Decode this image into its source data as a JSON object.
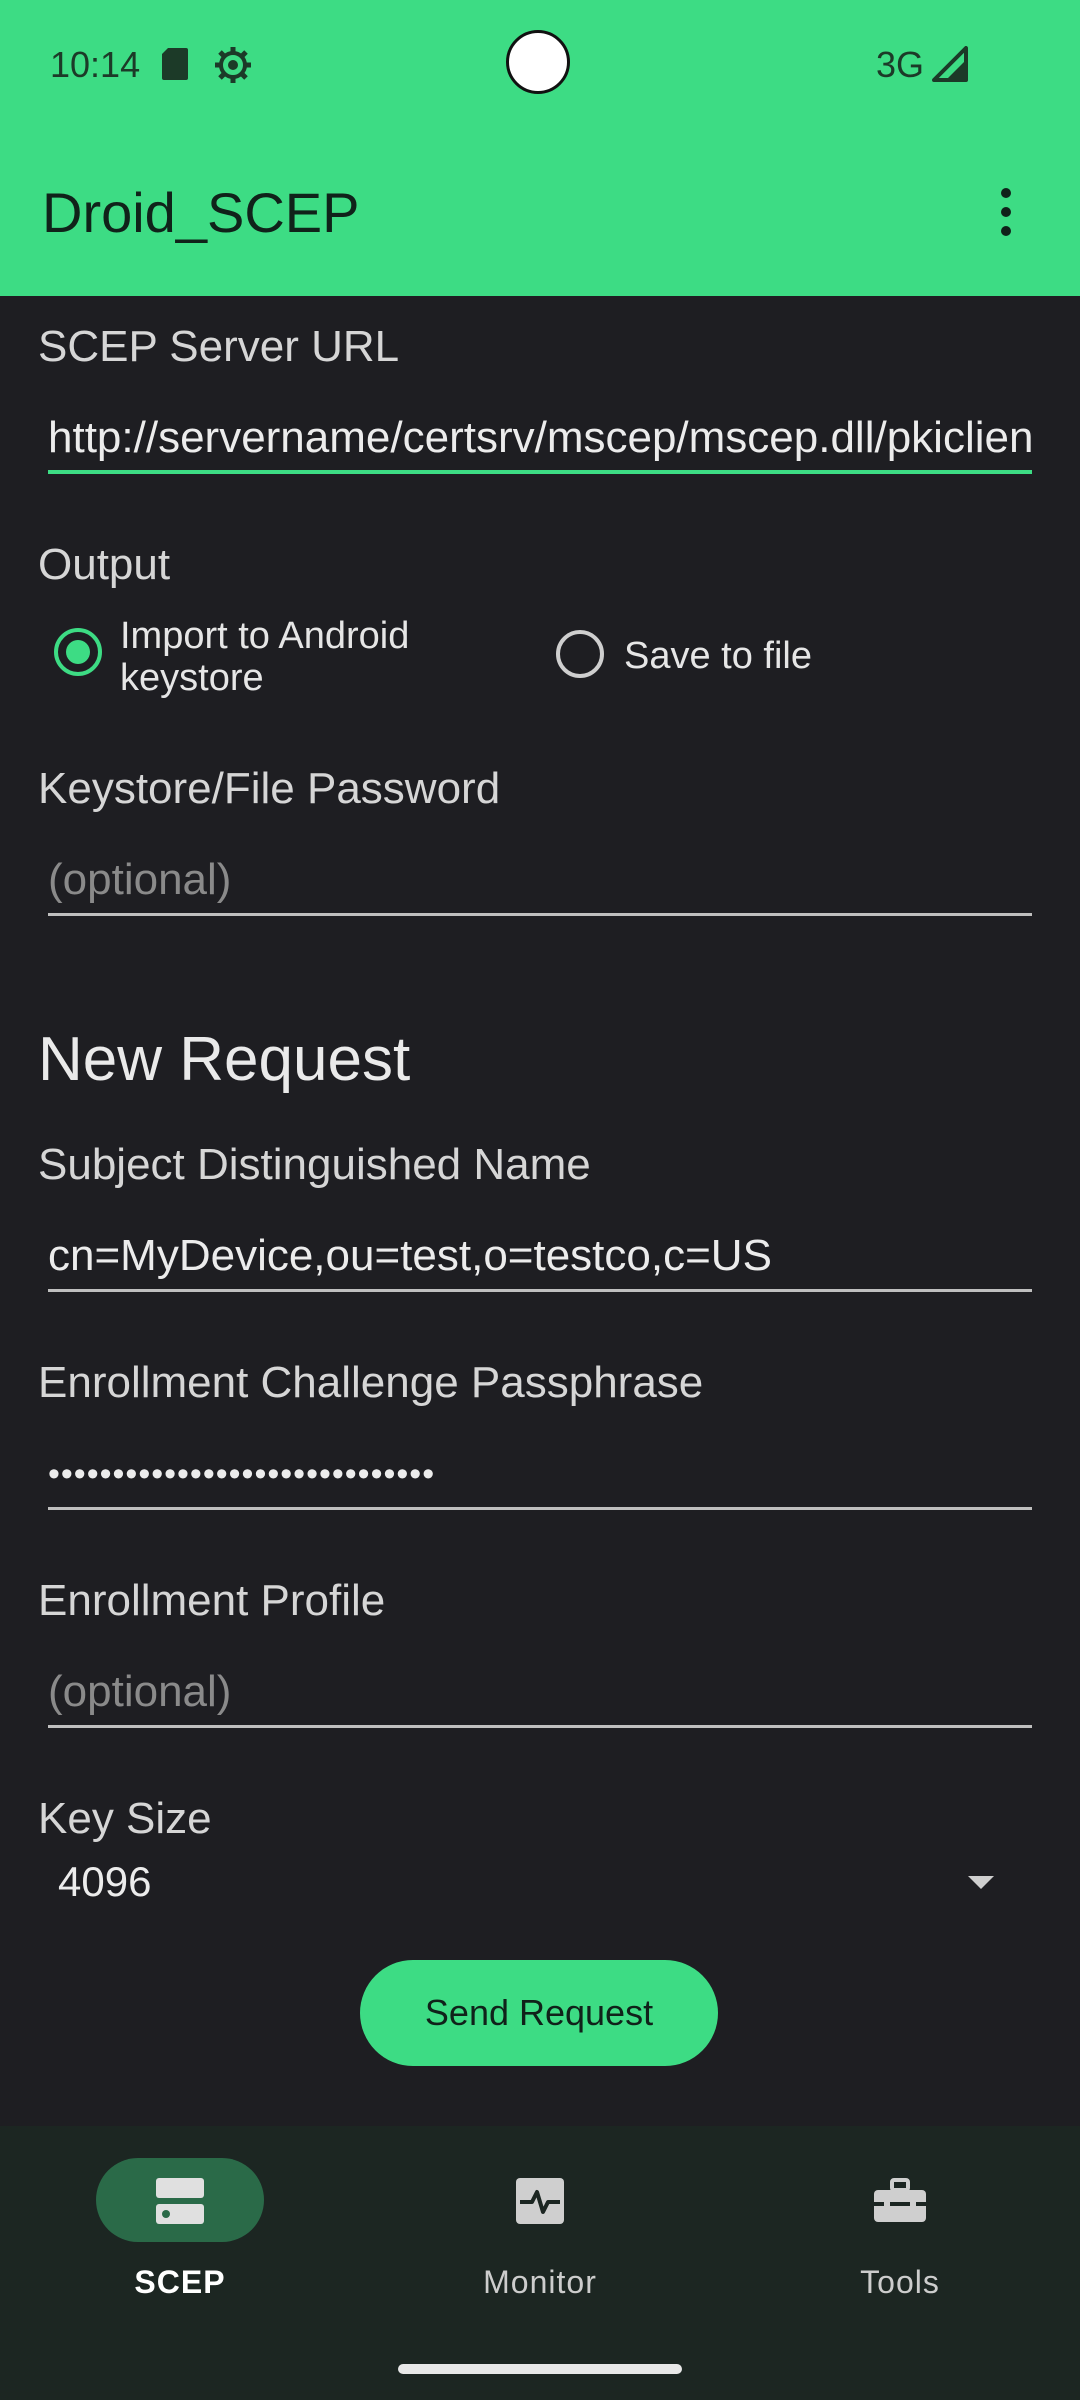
{
  "status_bar": {
    "time": "10:14",
    "network": "3G"
  },
  "app_bar": {
    "title": "Droid_SCEP"
  },
  "server": {
    "label": "SCEP Server URL",
    "value": "http://servername/certsrv/mscep/mscep.dll/pkiclient.exe"
  },
  "output": {
    "label": "Output",
    "options": [
      {
        "line1": "Import to Android",
        "line2": "keystore",
        "selected": true
      },
      {
        "label": "Save to file",
        "selected": false
      }
    ]
  },
  "password": {
    "label": "Keystore/File Password",
    "placeholder": "(optional)"
  },
  "new_request": {
    "title": "New Request",
    "subject": {
      "label": "Subject Distinguished Name",
      "value": "cn=MyDevice,ou=test,o=testco,c=US"
    },
    "challenge": {
      "label": "Enrollment Challenge Passphrase",
      "value": "••••••••••••••••••••••••••••••"
    },
    "profile": {
      "label": "Enrollment Profile",
      "placeholder": "(optional)"
    },
    "key_size": {
      "label": "Key Size",
      "value": "4096"
    },
    "send_label": "Send Request"
  },
  "bottom_nav": {
    "items": [
      {
        "label": "SCEP",
        "icon": "server-icon",
        "active": true
      },
      {
        "label": "Monitor",
        "icon": "monitor-icon",
        "active": false
      },
      {
        "label": "Tools",
        "icon": "toolbox-icon",
        "active": false
      }
    ]
  },
  "colors": {
    "accent": "#3ddc84",
    "background": "#1e1e22",
    "nav_background": "#1c2622"
  }
}
